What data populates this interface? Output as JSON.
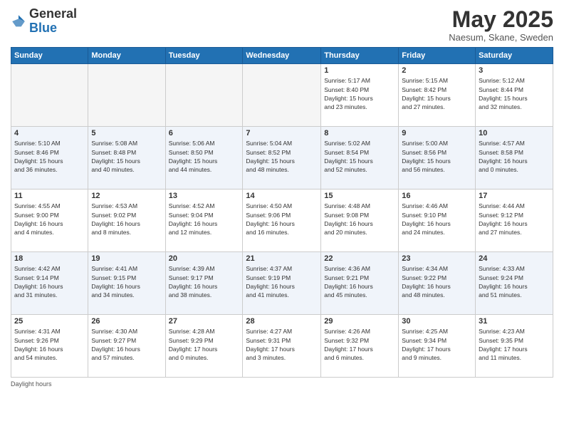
{
  "logo": {
    "general": "General",
    "blue": "Blue"
  },
  "title": "May 2025",
  "subtitle": "Naesum, Skane, Sweden",
  "days_of_week": [
    "Sunday",
    "Monday",
    "Tuesday",
    "Wednesday",
    "Thursday",
    "Friday",
    "Saturday"
  ],
  "weeks": [
    [
      {
        "day": "",
        "info": ""
      },
      {
        "day": "",
        "info": ""
      },
      {
        "day": "",
        "info": ""
      },
      {
        "day": "",
        "info": ""
      },
      {
        "day": "1",
        "info": "Sunrise: 5:17 AM\nSunset: 8:40 PM\nDaylight: 15 hours\nand 23 minutes."
      },
      {
        "day": "2",
        "info": "Sunrise: 5:15 AM\nSunset: 8:42 PM\nDaylight: 15 hours\nand 27 minutes."
      },
      {
        "day": "3",
        "info": "Sunrise: 5:12 AM\nSunset: 8:44 PM\nDaylight: 15 hours\nand 32 minutes."
      }
    ],
    [
      {
        "day": "4",
        "info": "Sunrise: 5:10 AM\nSunset: 8:46 PM\nDaylight: 15 hours\nand 36 minutes."
      },
      {
        "day": "5",
        "info": "Sunrise: 5:08 AM\nSunset: 8:48 PM\nDaylight: 15 hours\nand 40 minutes."
      },
      {
        "day": "6",
        "info": "Sunrise: 5:06 AM\nSunset: 8:50 PM\nDaylight: 15 hours\nand 44 minutes."
      },
      {
        "day": "7",
        "info": "Sunrise: 5:04 AM\nSunset: 8:52 PM\nDaylight: 15 hours\nand 48 minutes."
      },
      {
        "day": "8",
        "info": "Sunrise: 5:02 AM\nSunset: 8:54 PM\nDaylight: 15 hours\nand 52 minutes."
      },
      {
        "day": "9",
        "info": "Sunrise: 5:00 AM\nSunset: 8:56 PM\nDaylight: 15 hours\nand 56 minutes."
      },
      {
        "day": "10",
        "info": "Sunrise: 4:57 AM\nSunset: 8:58 PM\nDaylight: 16 hours\nand 0 minutes."
      }
    ],
    [
      {
        "day": "11",
        "info": "Sunrise: 4:55 AM\nSunset: 9:00 PM\nDaylight: 16 hours\nand 4 minutes."
      },
      {
        "day": "12",
        "info": "Sunrise: 4:53 AM\nSunset: 9:02 PM\nDaylight: 16 hours\nand 8 minutes."
      },
      {
        "day": "13",
        "info": "Sunrise: 4:52 AM\nSunset: 9:04 PM\nDaylight: 16 hours\nand 12 minutes."
      },
      {
        "day": "14",
        "info": "Sunrise: 4:50 AM\nSunset: 9:06 PM\nDaylight: 16 hours\nand 16 minutes."
      },
      {
        "day": "15",
        "info": "Sunrise: 4:48 AM\nSunset: 9:08 PM\nDaylight: 16 hours\nand 20 minutes."
      },
      {
        "day": "16",
        "info": "Sunrise: 4:46 AM\nSunset: 9:10 PM\nDaylight: 16 hours\nand 24 minutes."
      },
      {
        "day": "17",
        "info": "Sunrise: 4:44 AM\nSunset: 9:12 PM\nDaylight: 16 hours\nand 27 minutes."
      }
    ],
    [
      {
        "day": "18",
        "info": "Sunrise: 4:42 AM\nSunset: 9:14 PM\nDaylight: 16 hours\nand 31 minutes."
      },
      {
        "day": "19",
        "info": "Sunrise: 4:41 AM\nSunset: 9:15 PM\nDaylight: 16 hours\nand 34 minutes."
      },
      {
        "day": "20",
        "info": "Sunrise: 4:39 AM\nSunset: 9:17 PM\nDaylight: 16 hours\nand 38 minutes."
      },
      {
        "day": "21",
        "info": "Sunrise: 4:37 AM\nSunset: 9:19 PM\nDaylight: 16 hours\nand 41 minutes."
      },
      {
        "day": "22",
        "info": "Sunrise: 4:36 AM\nSunset: 9:21 PM\nDaylight: 16 hours\nand 45 minutes."
      },
      {
        "day": "23",
        "info": "Sunrise: 4:34 AM\nSunset: 9:22 PM\nDaylight: 16 hours\nand 48 minutes."
      },
      {
        "day": "24",
        "info": "Sunrise: 4:33 AM\nSunset: 9:24 PM\nDaylight: 16 hours\nand 51 minutes."
      }
    ],
    [
      {
        "day": "25",
        "info": "Sunrise: 4:31 AM\nSunset: 9:26 PM\nDaylight: 16 hours\nand 54 minutes."
      },
      {
        "day": "26",
        "info": "Sunrise: 4:30 AM\nSunset: 9:27 PM\nDaylight: 16 hours\nand 57 minutes."
      },
      {
        "day": "27",
        "info": "Sunrise: 4:28 AM\nSunset: 9:29 PM\nDaylight: 17 hours\nand 0 minutes."
      },
      {
        "day": "28",
        "info": "Sunrise: 4:27 AM\nSunset: 9:31 PM\nDaylight: 17 hours\nand 3 minutes."
      },
      {
        "day": "29",
        "info": "Sunrise: 4:26 AM\nSunset: 9:32 PM\nDaylight: 17 hours\nand 6 minutes."
      },
      {
        "day": "30",
        "info": "Sunrise: 4:25 AM\nSunset: 9:34 PM\nDaylight: 17 hours\nand 9 minutes."
      },
      {
        "day": "31",
        "info": "Sunrise: 4:23 AM\nSunset: 9:35 PM\nDaylight: 17 hours\nand 11 minutes."
      }
    ]
  ],
  "footer": {
    "daylight_label": "Daylight hours"
  }
}
